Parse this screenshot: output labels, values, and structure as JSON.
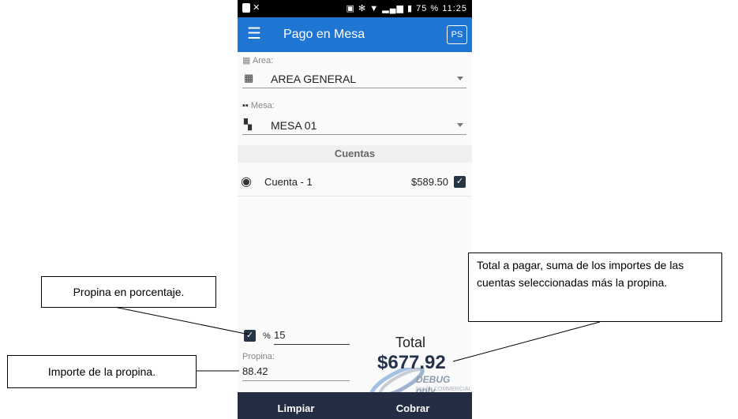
{
  "status_bar": {
    "battery": "75 %",
    "time": "11:25"
  },
  "app_bar": {
    "title": "Pago en Mesa",
    "logo": "PS",
    "menu_icon": "hamburger-icon"
  },
  "area": {
    "label": "Area:",
    "value": "AREA GENERAL"
  },
  "mesa": {
    "label": "Mesa:",
    "value": "MESA 01"
  },
  "cuentas": {
    "header": "Cuentas",
    "items": [
      {
        "name": "Cuenta - 1",
        "amount": "$589.50",
        "checked": true
      }
    ]
  },
  "propina": {
    "percent_symbol": "%",
    "percent_value": "15",
    "label": "Propina:",
    "value": "88.42"
  },
  "total": {
    "label": "Total",
    "value": "$677.92"
  },
  "watermark": {
    "line1": "DEBUG only",
    "line2": "Not for COMMERCIAL"
  },
  "buttons": {
    "limpiar": "Limpiar",
    "cobrar": "Cobrar"
  },
  "callouts": {
    "porcentaje": "Propina en porcentaje.",
    "importe": "Importe de la propina.",
    "total": "Total a pagar, suma de los importes de las cuentas seleccionadas más la propina."
  },
  "colors": {
    "app_bar": "#1e76d2",
    "bottom_bar": "#232d44",
    "checkbox": "#263646"
  }
}
